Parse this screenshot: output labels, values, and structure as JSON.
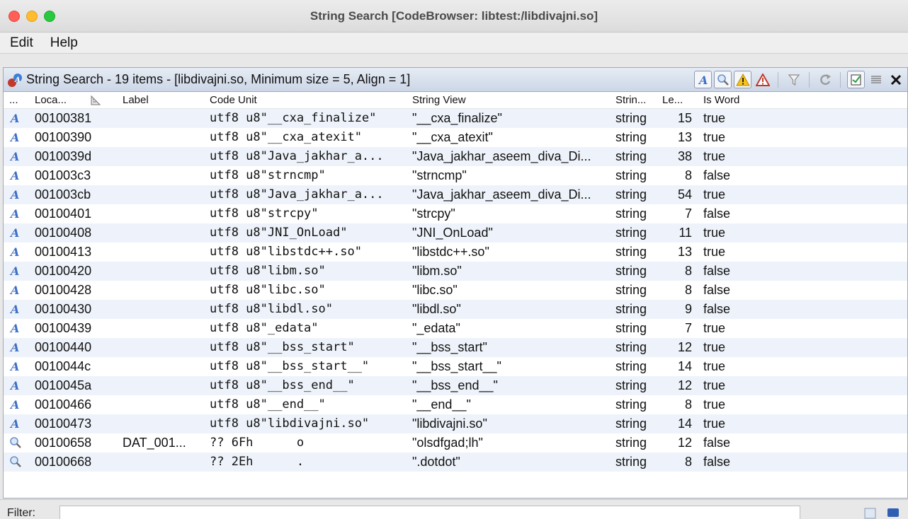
{
  "window": {
    "title": "String Search [CodeBrowser: libtest:/libdivajni.so]"
  },
  "menu": [
    "Edit",
    "Help"
  ],
  "panel": {
    "title": "String Search - 19 items - [libdivajni.so, Minimum size = 5, Align = 1]"
  },
  "columns": {
    "icon": "...",
    "location": "Loca...",
    "label": "Label",
    "code_unit": "Code Unit",
    "string_view": "String View",
    "string_type": "Strin...",
    "length": "Le...",
    "is_word": "Is Word"
  },
  "rows": [
    {
      "icon": "string",
      "location": "00100381",
      "label": "",
      "code_unit": "utf8 u8\"__cxa_finalize\"",
      "string_view": "\"__cxa_finalize\"",
      "string_type": "string",
      "length": "15",
      "is_word": "true"
    },
    {
      "icon": "string",
      "location": "00100390",
      "label": "",
      "code_unit": "utf8 u8\"__cxa_atexit\"",
      "string_view": "\"__cxa_atexit\"",
      "string_type": "string",
      "length": "13",
      "is_word": "true"
    },
    {
      "icon": "string",
      "location": "0010039d",
      "label": "",
      "code_unit": "utf8 u8\"Java_jakhar_a...",
      "string_view": "\"Java_jakhar_aseem_diva_Di...",
      "string_type": "string",
      "length": "38",
      "is_word": "true"
    },
    {
      "icon": "string",
      "location": "001003c3",
      "label": "",
      "code_unit": "utf8 u8\"strncmp\"",
      "string_view": "\"strncmp\"",
      "string_type": "string",
      "length": "8",
      "is_word": "false"
    },
    {
      "icon": "string",
      "location": "001003cb",
      "label": "",
      "code_unit": "utf8 u8\"Java_jakhar_a...",
      "string_view": "\"Java_jakhar_aseem_diva_Di...",
      "string_type": "string",
      "length": "54",
      "is_word": "true"
    },
    {
      "icon": "string",
      "location": "00100401",
      "label": "",
      "code_unit": "utf8 u8\"strcpy\"",
      "string_view": "\"strcpy\"",
      "string_type": "string",
      "length": "7",
      "is_word": "false"
    },
    {
      "icon": "string",
      "location": "00100408",
      "label": "",
      "code_unit": "utf8 u8\"JNI_OnLoad\"",
      "string_view": "\"JNI_OnLoad\"",
      "string_type": "string",
      "length": "11",
      "is_word": "true"
    },
    {
      "icon": "string",
      "location": "00100413",
      "label": "",
      "code_unit": "utf8 u8\"libstdc++.so\"",
      "string_view": "\"libstdc++.so\"",
      "string_type": "string",
      "length": "13",
      "is_word": "true"
    },
    {
      "icon": "string",
      "location": "00100420",
      "label": "",
      "code_unit": "utf8 u8\"libm.so\"",
      "string_view": "\"libm.so\"",
      "string_type": "string",
      "length": "8",
      "is_word": "false"
    },
    {
      "icon": "string",
      "location": "00100428",
      "label": "",
      "code_unit": "utf8 u8\"libc.so\"",
      "string_view": "\"libc.so\"",
      "string_type": "string",
      "length": "8",
      "is_word": "false"
    },
    {
      "icon": "string",
      "location": "00100430",
      "label": "",
      "code_unit": "utf8 u8\"libdl.so\"",
      "string_view": "\"libdl.so\"",
      "string_type": "string",
      "length": "9",
      "is_word": "false"
    },
    {
      "icon": "string",
      "location": "00100439",
      "label": "",
      "code_unit": "utf8 u8\"_edata\"",
      "string_view": "\"_edata\"",
      "string_type": "string",
      "length": "7",
      "is_word": "true"
    },
    {
      "icon": "string",
      "location": "00100440",
      "label": "",
      "code_unit": "utf8 u8\"__bss_start\"",
      "string_view": "\"__bss_start\"",
      "string_type": "string",
      "length": "12",
      "is_word": "true"
    },
    {
      "icon": "string",
      "location": "0010044c",
      "label": "",
      "code_unit": "utf8 u8\"__bss_start__\"",
      "string_view": "\"__bss_start__\"",
      "string_type": "string",
      "length": "14",
      "is_word": "true"
    },
    {
      "icon": "string",
      "location": "0010045a",
      "label": "",
      "code_unit": "utf8 u8\"__bss_end__\"",
      "string_view": "\"__bss_end__\"",
      "string_type": "string",
      "length": "12",
      "is_word": "true"
    },
    {
      "icon": "string",
      "location": "00100466",
      "label": "",
      "code_unit": "utf8 u8\"__end__\"",
      "string_view": "\"__end__\"",
      "string_type": "string",
      "length": "8",
      "is_word": "true"
    },
    {
      "icon": "string",
      "location": "00100473",
      "label": "",
      "code_unit": "utf8 u8\"libdivajni.so\"",
      "string_view": "\"libdivajni.so\"",
      "string_type": "string",
      "length": "14",
      "is_word": "true"
    },
    {
      "icon": "search",
      "location": "00100658",
      "label": "DAT_001...",
      "code_unit": "?? 6Fh      o",
      "string_view": "\"olsdfgad;lh\"",
      "string_type": "string",
      "length": "12",
      "is_word": "false"
    },
    {
      "icon": "search",
      "location": "00100668",
      "label": "",
      "code_unit": "?? 2Eh      .",
      "string_view": "\".dotdot\"",
      "string_type": "string",
      "length": "8",
      "is_word": "false"
    }
  ],
  "filter": {
    "label": "Filter:",
    "value": ""
  }
}
